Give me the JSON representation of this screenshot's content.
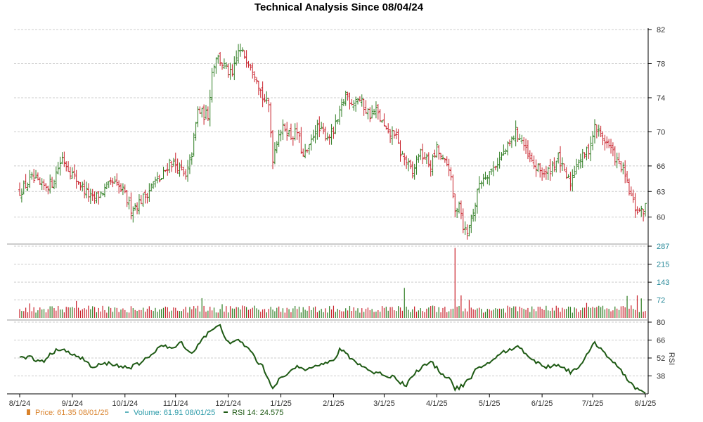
{
  "chart_data": {
    "type": "ohlc",
    "title": "Technical Analysis Since 08/04/24",
    "x_tick_labels": [
      "8/1/24",
      "9/1/24",
      "10/1/24",
      "11/1/24",
      "12/1/24",
      "1/1/25",
      "2/1/25",
      "3/1/25",
      "4/1/25",
      "5/1/25",
      "6/1/25",
      "7/1/25",
      "8/1/25"
    ],
    "price_panel": {
      "ylim": [
        57,
        82
      ],
      "y_ticks": [
        "82",
        "78",
        "74",
        "70",
        "66",
        "63",
        "60"
      ],
      "price_anchors": [
        [
          0,
          63.0
        ],
        [
          6,
          64.5
        ],
        [
          11,
          63.5
        ],
        [
          16,
          64.0
        ],
        [
          21,
          67.0
        ],
        [
          26,
          65.0
        ],
        [
          31,
          63.5
        ],
        [
          36,
          62.0
        ],
        [
          41,
          63.0
        ],
        [
          46,
          64.0
        ],
        [
          51,
          63.0
        ],
        [
          55,
          61.0
        ],
        [
          58,
          61.5
        ],
        [
          62,
          62.5
        ],
        [
          66,
          64.0
        ],
        [
          70,
          64.5
        ],
        [
          74,
          66.5
        ],
        [
          78,
          66.0
        ],
        [
          82,
          64.5
        ],
        [
          85,
          67.5
        ],
        [
          88,
          72.5
        ],
        [
          91,
          72.0
        ],
        [
          93,
          72.0
        ],
        [
          95,
          77.0
        ],
        [
          97,
          79.0
        ],
        [
          100,
          78.0
        ],
        [
          103,
          77.0
        ],
        [
          105,
          76.5
        ],
        [
          108,
          79.5
        ],
        [
          111,
          79.0
        ],
        [
          114,
          78.0
        ],
        [
          117,
          76.5
        ],
        [
          120,
          74.0
        ],
        [
          123,
          73.0
        ],
        [
          125,
          67.0
        ],
        [
          128,
          70.0
        ],
        [
          131,
          70.5
        ],
        [
          134,
          69.5
        ],
        [
          137,
          70.0
        ],
        [
          140,
          67.0
        ],
        [
          143,
          68.0
        ],
        [
          146,
          70.5
        ],
        [
          149,
          70.0
        ],
        [
          152,
          69.5
        ],
        [
          155,
          70.0
        ],
        [
          158,
          72.0
        ],
        [
          161,
          74.5
        ],
        [
          164,
          73.5
        ],
        [
          167,
          74.0
        ],
        [
          170,
          73.0
        ],
        [
          173,
          72.0
        ],
        [
          176,
          72.5
        ],
        [
          179,
          71.0
        ],
        [
          182,
          69.5
        ],
        [
          185,
          70.0
        ],
        [
          188,
          67.5
        ],
        [
          191,
          66.5
        ],
        [
          194,
          65.0
        ],
        [
          197,
          67.5
        ],
        [
          200,
          67.0
        ],
        [
          203,
          66.0
        ],
        [
          206,
          68.0
        ],
        [
          209,
          66.5
        ],
        [
          212,
          66.0
        ],
        [
          215,
          60.5
        ],
        [
          217,
          62.0
        ],
        [
          219,
          59.0
        ],
        [
          221,
          58.0
        ],
        [
          223,
          60.0
        ],
        [
          225,
          61.5
        ],
        [
          227,
          64.0
        ],
        [
          230,
          65.0
        ],
        [
          233,
          65.5
        ],
        [
          236,
          66.5
        ],
        [
          239,
          67.5
        ],
        [
          242,
          68.5
        ],
        [
          245,
          70.0
        ],
        [
          248,
          69.0
        ],
        [
          251,
          67.0
        ],
        [
          254,
          66.0
        ],
        [
          257,
          65.5
        ],
        [
          260,
          65.0
        ],
        [
          263,
          66.0
        ],
        [
          266,
          67.0
        ],
        [
          269,
          65.0
        ],
        [
          272,
          64.0
        ],
        [
          275,
          66.5
        ],
        [
          278,
          67.0
        ],
        [
          281,
          68.0
        ],
        [
          284,
          70.5
        ],
        [
          286,
          70.0
        ],
        [
          289,
          69.0
        ],
        [
          292,
          68.0
        ],
        [
          295,
          66.5
        ],
        [
          298,
          65.5
        ],
        [
          301,
          63.0
        ],
        [
          304,
          61.0
        ],
        [
          307,
          60.5
        ],
        [
          309,
          61.2
        ]
      ]
    },
    "volume_panel": {
      "ylim": [
        0,
        287
      ],
      "y_ticks": [
        "287",
        "215",
        "143",
        "72"
      ],
      "spikes": [
        [
          5,
          58
        ],
        [
          14,
          35
        ],
        [
          28,
          68
        ],
        [
          58,
          28
        ],
        [
          90,
          79
        ],
        [
          100,
          55
        ],
        [
          190,
          120
        ],
        [
          215,
          280
        ],
        [
          218,
          90
        ],
        [
          222,
          72
        ],
        [
          280,
          60
        ],
        [
          300,
          88
        ],
        [
          302,
          50
        ],
        [
          305,
          90
        ],
        [
          307,
          78
        ]
      ],
      "base_level": 38
    },
    "rsi_panel": {
      "ylim": [
        24,
        80
      ],
      "y_ticks": [
        "80",
        "66",
        "52",
        "38"
      ],
      "axis_label": "RSI",
      "rsi_anchors": [
        [
          0,
          52
        ],
        [
          5,
          53
        ],
        [
          8,
          50
        ],
        [
          12,
          50
        ],
        [
          16,
          56
        ],
        [
          21,
          60
        ],
        [
          26,
          54
        ],
        [
          31,
          52
        ],
        [
          36,
          44
        ],
        [
          40,
          47
        ],
        [
          45,
          48
        ],
        [
          50,
          45
        ],
        [
          55,
          45
        ],
        [
          60,
          48
        ],
        [
          65,
          55
        ],
        [
          70,
          62
        ],
        [
          75,
          59
        ],
        [
          80,
          64
        ],
        [
          85,
          55
        ],
        [
          90,
          67
        ],
        [
          95,
          74
        ],
        [
          99,
          77
        ],
        [
          102,
          67
        ],
        [
          105,
          63
        ],
        [
          108,
          66
        ],
        [
          111,
          62
        ],
        [
          114,
          58
        ],
        [
          117,
          50
        ],
        [
          120,
          45
        ],
        [
          123,
          35
        ],
        [
          125,
          29
        ],
        [
          128,
          35
        ],
        [
          131,
          38
        ],
        [
          134,
          41
        ],
        [
          137,
          46
        ],
        [
          140,
          43
        ],
        [
          143,
          45
        ],
        [
          146,
          47
        ],
        [
          149,
          47
        ],
        [
          152,
          48
        ],
        [
          155,
          50
        ],
        [
          158,
          58
        ],
        [
          161,
          56
        ],
        [
          164,
          51
        ],
        [
          167,
          48
        ],
        [
          170,
          45
        ],
        [
          173,
          42
        ],
        [
          176,
          40
        ],
        [
          179,
          40
        ],
        [
          182,
          37
        ],
        [
          185,
          38
        ],
        [
          188,
          33
        ],
        [
          191,
          31
        ],
        [
          194,
          38
        ],
        [
          197,
          43
        ],
        [
          200,
          46
        ],
        [
          203,
          49
        ],
        [
          206,
          44
        ],
        [
          209,
          39
        ],
        [
          212,
          37
        ],
        [
          215,
          28
        ],
        [
          217,
          29
        ],
        [
          219,
          31
        ],
        [
          221,
          34
        ],
        [
          223,
          36
        ],
        [
          225,
          42
        ],
        [
          227,
          44
        ],
        [
          230,
          47
        ],
        [
          233,
          50
        ],
        [
          236,
          53
        ],
        [
          239,
          57
        ],
        [
          242,
          58
        ],
        [
          245,
          61
        ],
        [
          248,
          59
        ],
        [
          251,
          54
        ],
        [
          254,
          50
        ],
        [
          257,
          47
        ],
        [
          260,
          45
        ],
        [
          263,
          46
        ],
        [
          266,
          47
        ],
        [
          269,
          44
        ],
        [
          272,
          41
        ],
        [
          275,
          44
        ],
        [
          278,
          49
        ],
        [
          281,
          56
        ],
        [
          284,
          64
        ],
        [
          286,
          61
        ],
        [
          289,
          56
        ],
        [
          292,
          51
        ],
        [
          295,
          45
        ],
        [
          298,
          40
        ],
        [
          301,
          34
        ],
        [
          304,
          29
        ],
        [
          307,
          26
        ],
        [
          309,
          24.575
        ]
      ]
    },
    "legend": {
      "price_label": "Price: 61.35  08/01/25",
      "volume_label": "Volume: 61.91  08/01/25",
      "rsi_label": "RSI 14: 24.575"
    },
    "colors": {
      "up": "#2e7d22",
      "down": "#c8202a",
      "price_legend": "#d9822b",
      "volume_legend": "#2a9aa8",
      "rsi_line": "#1e5a14",
      "grid": "#cccccc",
      "axis": "#000000"
    }
  }
}
